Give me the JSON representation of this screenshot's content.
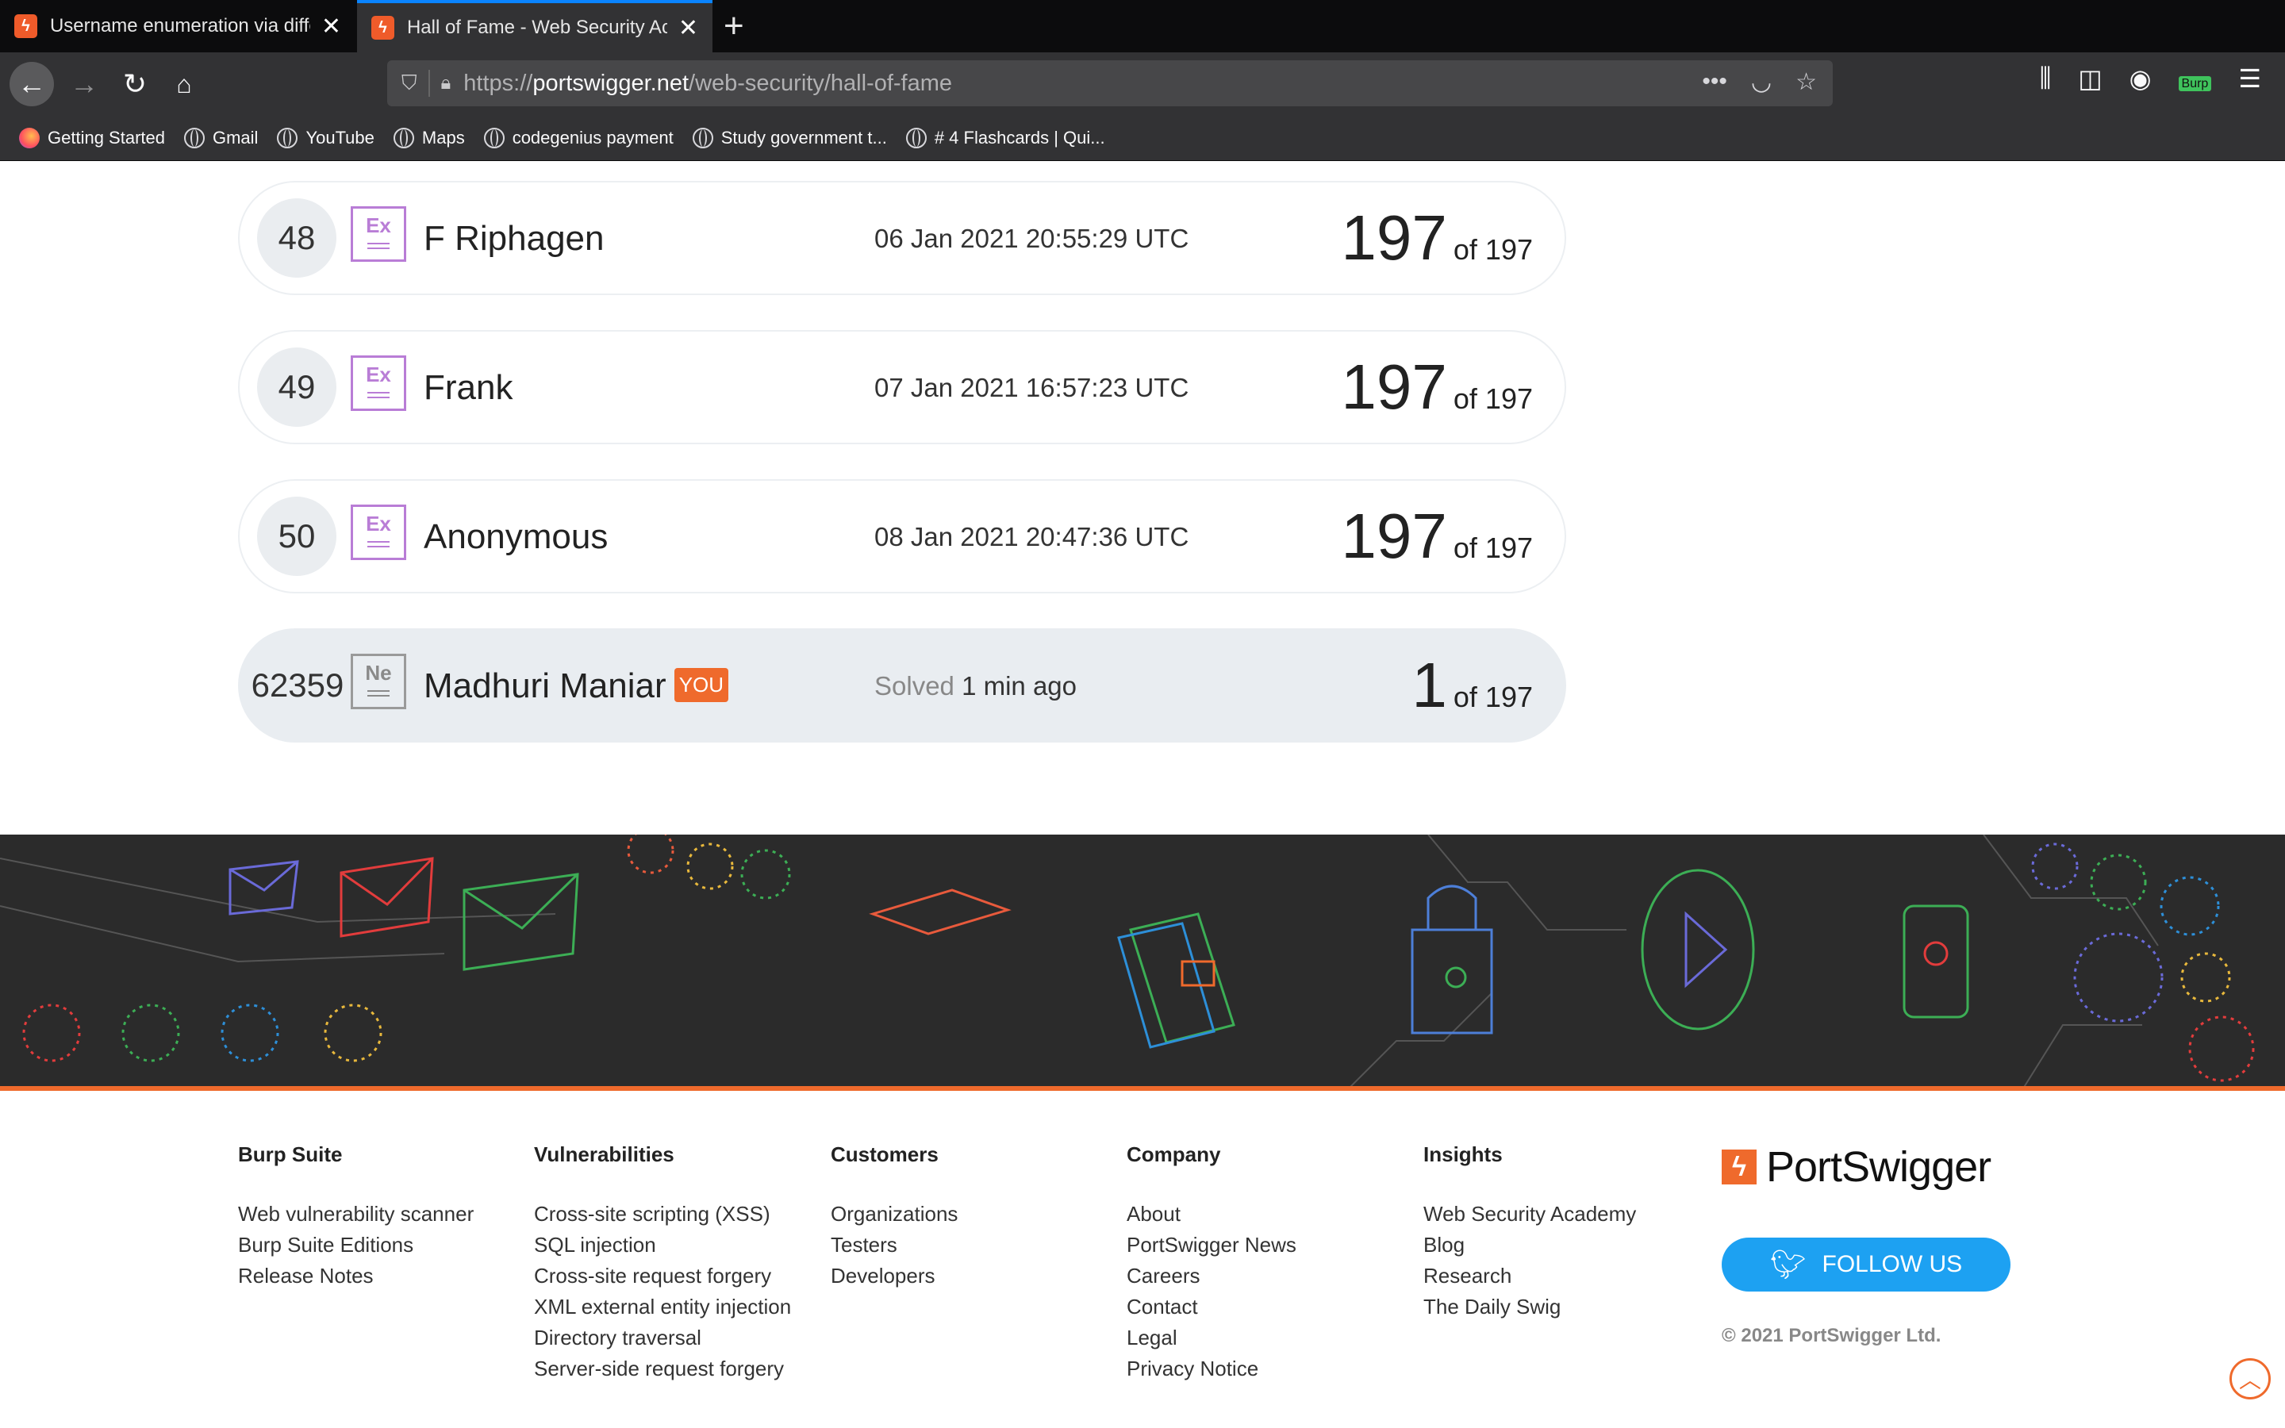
{
  "browser": {
    "tabs": [
      {
        "title": "Username enumeration via diffe",
        "active": false
      },
      {
        "title": "Hall of Fame - Web Security Ac",
        "active": true
      }
    ],
    "url_prefix": "https://",
    "url_domain": "portswigger.net",
    "url_path": "/web-security/hall-of-fame",
    "burp_badge": "Burp",
    "bookmarks": [
      "Getting Started",
      "Gmail",
      "YouTube",
      "Maps",
      "codegenius payment",
      "Study government t...",
      "# 4 Flashcards | Qui..."
    ]
  },
  "leaderboard": [
    {
      "rank": "48",
      "badge": "Ex",
      "name": "F Riphagen",
      "date": "06 Jan 2021 20:55:29 UTC",
      "solved": "197",
      "of": "of 197"
    },
    {
      "rank": "49",
      "badge": "Ex",
      "name": "Frank",
      "date": "07 Jan 2021 16:57:23 UTC",
      "solved": "197",
      "of": "of 197"
    },
    {
      "rank": "50",
      "badge": "Ex",
      "name": "Anonymous",
      "date": "08 Jan 2021 20:47:36 UTC",
      "solved": "197",
      "of": "of 197"
    },
    {
      "rank": "62359",
      "badge": "Ne",
      "name": "Madhuri Maniar",
      "you": "YOU",
      "solved_label": "Solved",
      "date": "1 min ago",
      "solved": "1",
      "of": "of 197"
    }
  ],
  "footer": {
    "columns": [
      {
        "title": "Burp Suite",
        "links": [
          "Web vulnerability scanner",
          "Burp Suite Editions",
          "Release Notes"
        ]
      },
      {
        "title": "Vulnerabilities",
        "links": [
          "Cross-site scripting (XSS)",
          "SQL injection",
          "Cross-site request forgery",
          "XML external entity injection",
          "Directory traversal",
          "Server-side request forgery"
        ]
      },
      {
        "title": "Customers",
        "links": [
          "Organizations",
          "Testers",
          "Developers"
        ]
      },
      {
        "title": "Company",
        "links": [
          "About",
          "PortSwigger News",
          "Careers",
          "Contact",
          "Legal",
          "Privacy Notice"
        ]
      },
      {
        "title": "Insights",
        "links": [
          "Web Security Academy",
          "Blog",
          "Research",
          "The Daily Swig"
        ]
      }
    ],
    "brand": "PortSwigger",
    "follow_label": "FOLLOW US",
    "copyright": "© 2021 PortSwigger Ltd."
  },
  "colors": {
    "accent": "#ef6a2c",
    "twitter": "#1da1f2",
    "badge_expert": "#b97dd6"
  }
}
